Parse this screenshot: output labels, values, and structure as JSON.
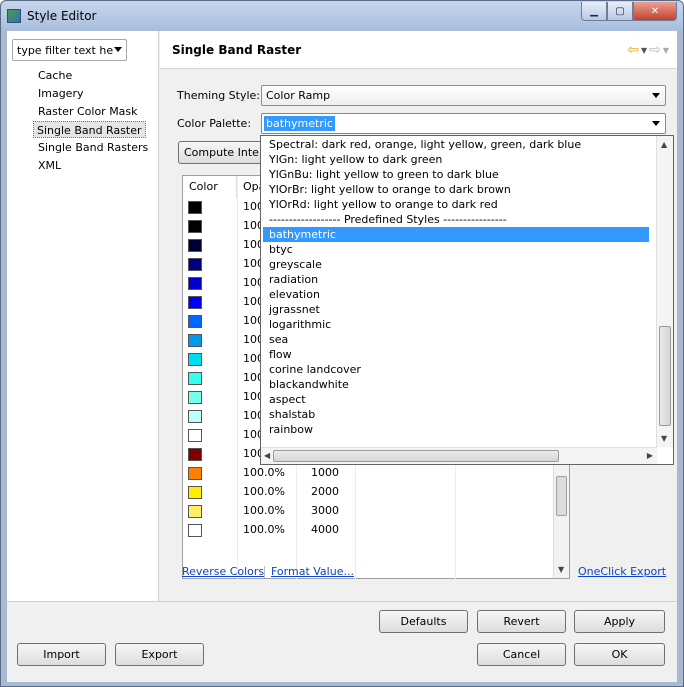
{
  "window": {
    "title": "Style Editor"
  },
  "filter": {
    "value": "type filter text he"
  },
  "tree": {
    "items": [
      {
        "label": "Cache"
      },
      {
        "label": "Imagery"
      },
      {
        "label": "Raster Color Mask"
      },
      {
        "label": "Single Band Raster"
      },
      {
        "label": "Single Band Rasters"
      },
      {
        "label": "XML"
      }
    ],
    "selected": "Single Band Raster"
  },
  "page": {
    "title": "Single Band Raster"
  },
  "form": {
    "theming_label": "Theming Style:",
    "theming_value": "Color Ramp",
    "palette_label": "Color Palette:",
    "palette_value": "bathymetric",
    "compute_button": "Compute Inter"
  },
  "table": {
    "headers": [
      "Color",
      "Opa"
    ],
    "rows": [
      {
        "color": "#000000",
        "opacity": "100"
      },
      {
        "color": "#000000",
        "opacity": "100"
      },
      {
        "color": "#000033",
        "opacity": "100"
      },
      {
        "color": "#000080",
        "opacity": "100"
      },
      {
        "color": "#0000cc",
        "opacity": "100"
      },
      {
        "color": "#0000ff",
        "opacity": "100"
      },
      {
        "color": "#0066ff",
        "opacity": "100"
      },
      {
        "color": "#0099ee",
        "opacity": "100"
      },
      {
        "color": "#00ddee",
        "opacity": "100"
      },
      {
        "color": "#33ffee",
        "opacity": "100"
      },
      {
        "color": "#77ffee",
        "opacity": "100"
      },
      {
        "color": "#bbffff",
        "opacity": "100"
      },
      {
        "color": "#ffffff",
        "opacity": "100"
      },
      {
        "color": "#800000",
        "opacity": "100"
      },
      {
        "color": "#ff8000",
        "opacity": "100.0%",
        "value": "1000"
      },
      {
        "color": "#ffee00",
        "opacity": "100.0%",
        "value": "2000"
      },
      {
        "color": "#ffee66",
        "opacity": "100.0%",
        "value": "3000"
      },
      {
        "color": "#ffffff",
        "opacity": "100.0%",
        "value": "4000"
      }
    ]
  },
  "dropdown": {
    "options": [
      "Spectral: dark red, orange, light yellow, green, dark blue",
      "YlGn: light yellow to dark green",
      "YlGnBu: light yellow to green to dark blue",
      "YlOrBr: light yellow to orange to dark brown",
      "YlOrRd: light yellow to orange to dark red",
      "------------------ Predefined Styles ----------------",
      "bathymetric",
      "btyc",
      "greyscale",
      "radiation",
      "elevation",
      "jgrassnet",
      "logarithmic",
      "sea",
      "flow",
      "corine landcover",
      "blackandwhite",
      "aspect",
      "shalstab",
      "rainbow"
    ],
    "selected_index": 6
  },
  "links": {
    "reverse": "Reverse Colors",
    "format": "Format Value...",
    "export": "OneClick Export"
  },
  "buttons": {
    "defaults": "Defaults",
    "revert": "Revert",
    "apply": "Apply",
    "import": "Import",
    "export": "Export",
    "cancel": "Cancel",
    "ok": "OK"
  }
}
